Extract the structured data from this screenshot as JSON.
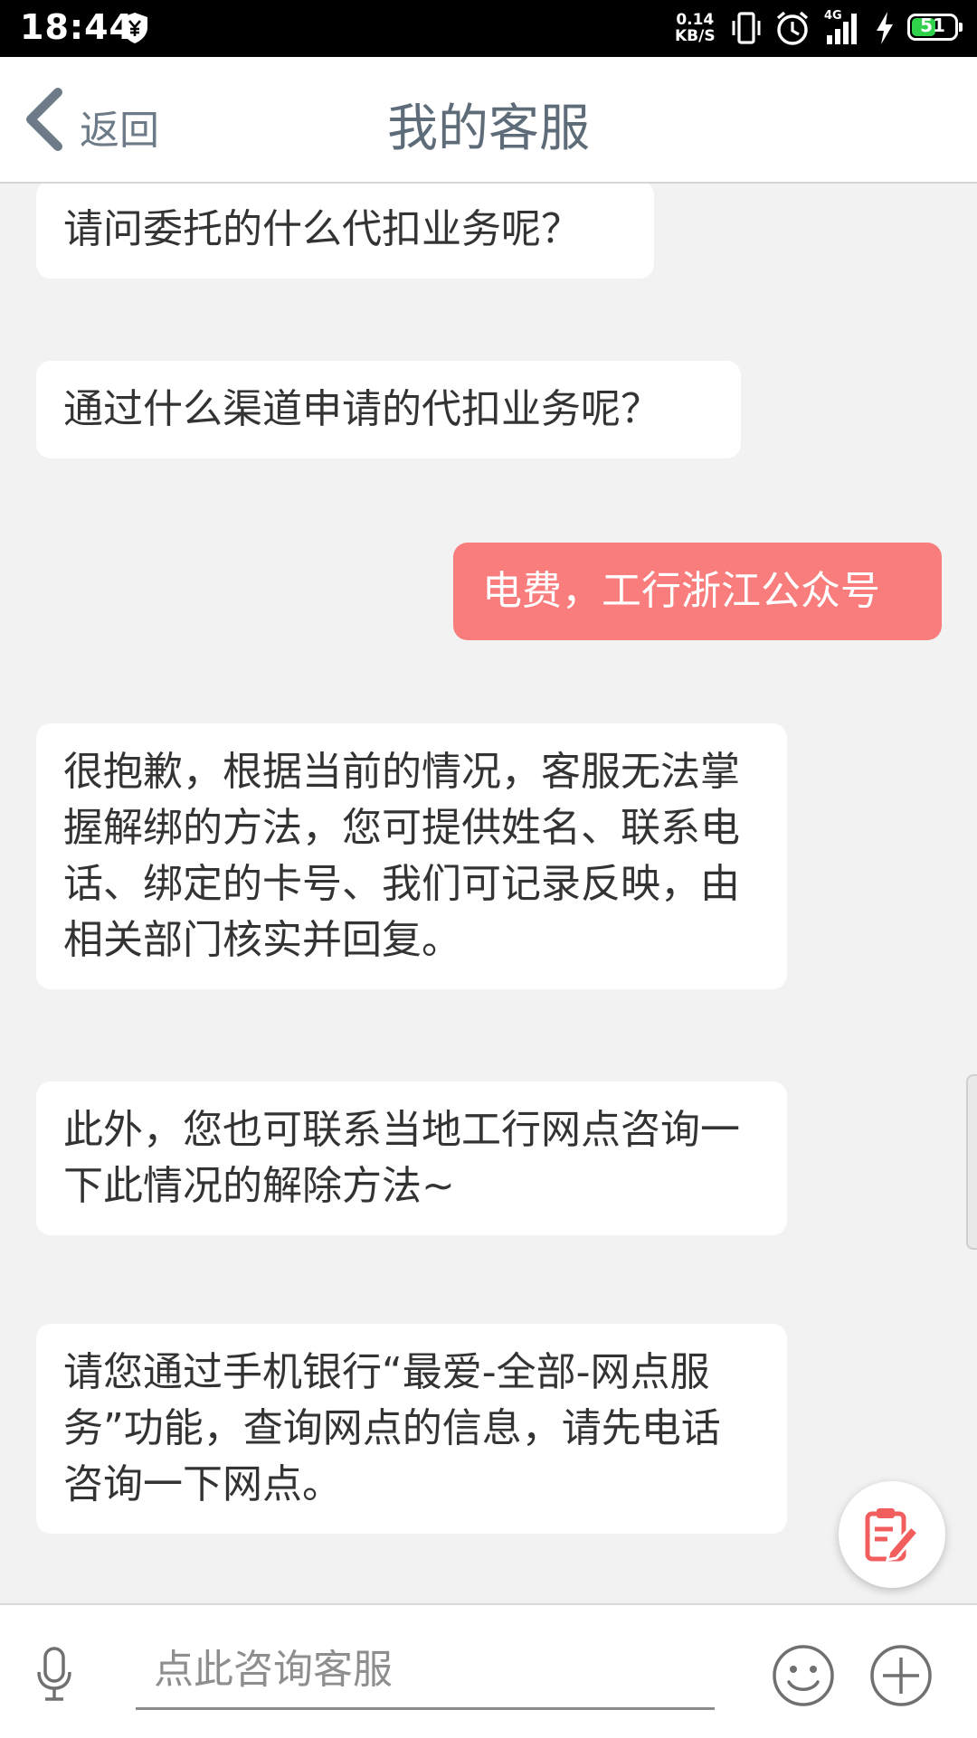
{
  "status_bar": {
    "time": "18:44",
    "speed_value": "0.14",
    "speed_unit": "KB/S",
    "network": "4G",
    "battery_level": "51"
  },
  "header": {
    "back_label": "返回",
    "title": "我的客服"
  },
  "messages": [
    {
      "from": "bot",
      "text": "请问委托的什么代扣业务呢？"
    },
    {
      "from": "bot",
      "text": "通过什么渠道申请的代扣业务呢？"
    },
    {
      "from": "user",
      "text": "电费，工行浙江公众号"
    },
    {
      "from": "bot",
      "text": "很抱歉，根据当前的情况，客服无法掌握解绑的方法，您可提供姓名、联系电话、绑定的卡号、我们可记录反映，由相关部门核实并回复。"
    },
    {
      "from": "bot",
      "text": "此外，您也可联系当地工行网点咨询一下此情况的解除方法~"
    },
    {
      "from": "bot",
      "text": "请您通过手机银行“最爱-全部-网点服务”功能，查询网点的信息，请先电话咨询一下网点。"
    }
  ],
  "input_bar": {
    "placeholder": "点此咨询客服"
  },
  "icons": {
    "back": "chevron-left-icon",
    "mic": "microphone-icon",
    "emoji": "smiley-icon",
    "plus": "plus-circle-icon",
    "fab": "edit-form-icon"
  },
  "colors": {
    "user_bubble": "#f97d7d",
    "bot_bubble": "#ffffff",
    "background": "#f2f2f2",
    "header_text": "#5e6c7a",
    "fab_icon": "#f25d5d"
  }
}
